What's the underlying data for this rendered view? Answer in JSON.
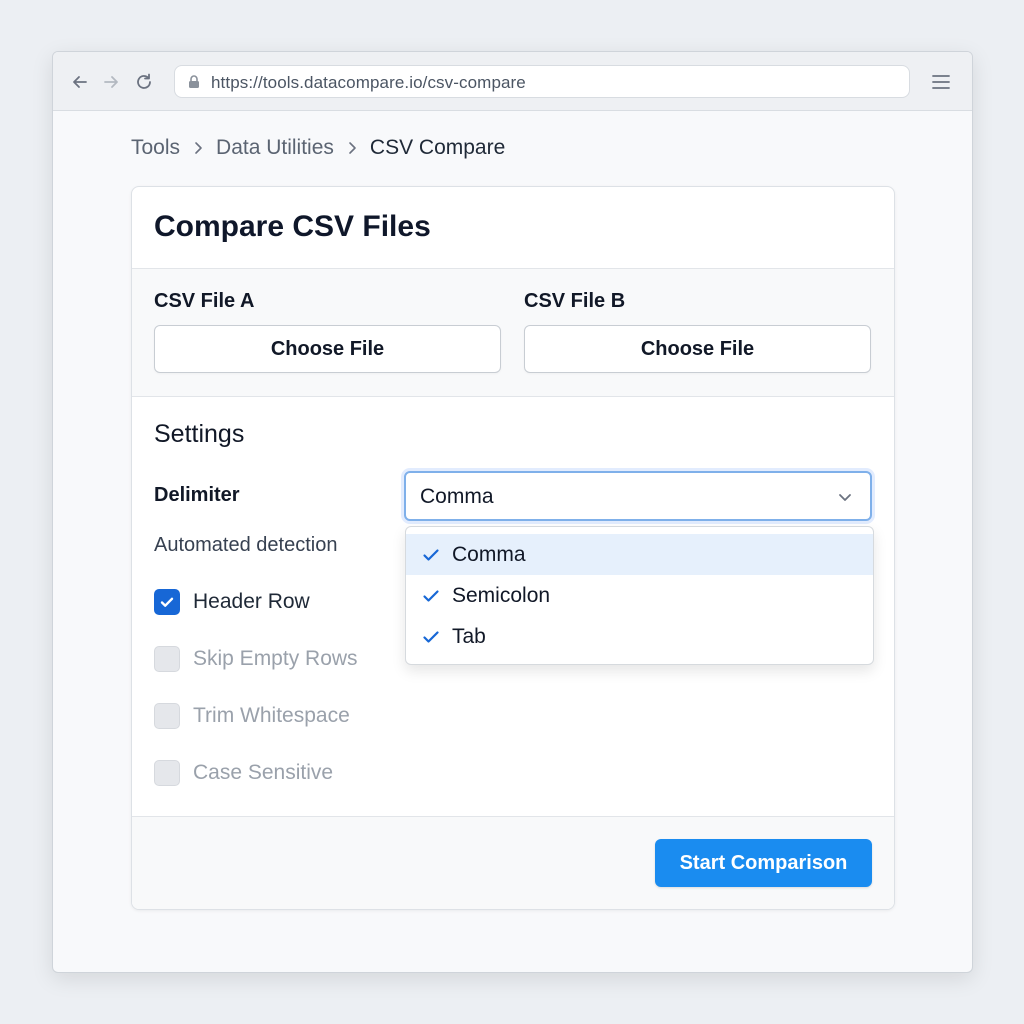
{
  "browser": {
    "url": "https://tools.datacompare.io/csv-compare",
    "back_icon": "arrow-left-icon",
    "forward_icon": "arrow-right-icon",
    "reload_icon": "reload-icon",
    "menu_icon": "hamburger-menu-icon"
  },
  "breadcrumb": {
    "items": [
      "Tools",
      "Data Utilities",
      "CSV Compare"
    ]
  },
  "card": {
    "title": "Compare CSV Files"
  },
  "files": {
    "file_a": {
      "label": "CSV File A",
      "button": "Choose File"
    },
    "file_b": {
      "label": "CSV File B",
      "button": "Choose File"
    }
  },
  "settings": {
    "title": "Settings",
    "delimiter_label": "Delimiter",
    "delimiter_value": "Comma",
    "delimiter_options": [
      "Comma",
      "Semicolon",
      "Tab"
    ],
    "highlighted_option": "Comma",
    "automated_detection_label": "Automated detection",
    "checkboxes": [
      {
        "label": "Header Row",
        "checked": true,
        "disabled": false
      },
      {
        "label": "Skip Empty Rows",
        "checked": false,
        "disabled": true
      },
      {
        "label": "Trim Whitespace",
        "checked": false,
        "disabled": true
      },
      {
        "label": "Case Sensitive",
        "checked": false,
        "disabled": true
      }
    ]
  },
  "footer": {
    "primary_button": "Start Comparison"
  },
  "colors": {
    "accent": "#1a8cf0",
    "checkbox_checked": "#1767d6",
    "option_highlight": "#e6f0fc",
    "select_focus_border": "#7fb0ea"
  }
}
